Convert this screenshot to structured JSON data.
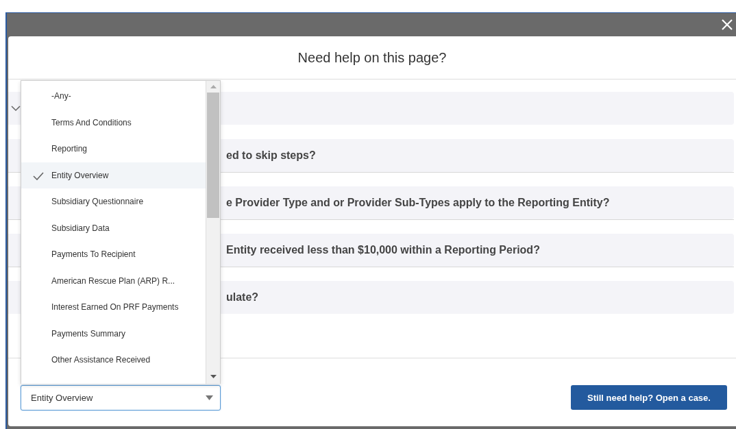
{
  "dialog": {
    "title": "Need help on this page?"
  },
  "questions": [
    {
      "chevron": true
    },
    {
      "text": "ed to skip steps?"
    },
    {
      "text": "e Provider Type and or Provider Sub-Types apply to the Reporting Entity?"
    },
    {
      "text": "Entity received less than $10,000 within a Reporting Period?"
    },
    {
      "text": "ulate?"
    }
  ],
  "section_select": {
    "value": "Entity Overview",
    "open": true,
    "options": [
      {
        "label": "-Any-",
        "selected": false
      },
      {
        "label": "Terms And Conditions",
        "selected": false
      },
      {
        "label": "Reporting",
        "selected": false
      },
      {
        "label": "Entity Overview",
        "selected": true
      },
      {
        "label": "Subsidiary Questionnaire",
        "selected": false
      },
      {
        "label": "Subsidiary Data",
        "selected": false
      },
      {
        "label": "Payments To Recipient",
        "selected": false
      },
      {
        "label": "American Rescue Plan (ARP) R...",
        "selected": false
      },
      {
        "label": "Interest Earned On PRF Payments",
        "selected": false
      },
      {
        "label": "Payments Summary",
        "selected": false
      },
      {
        "label": "Other Assistance Received",
        "selected": false
      }
    ]
  },
  "open_case_button": "Still need help? Open a case."
}
